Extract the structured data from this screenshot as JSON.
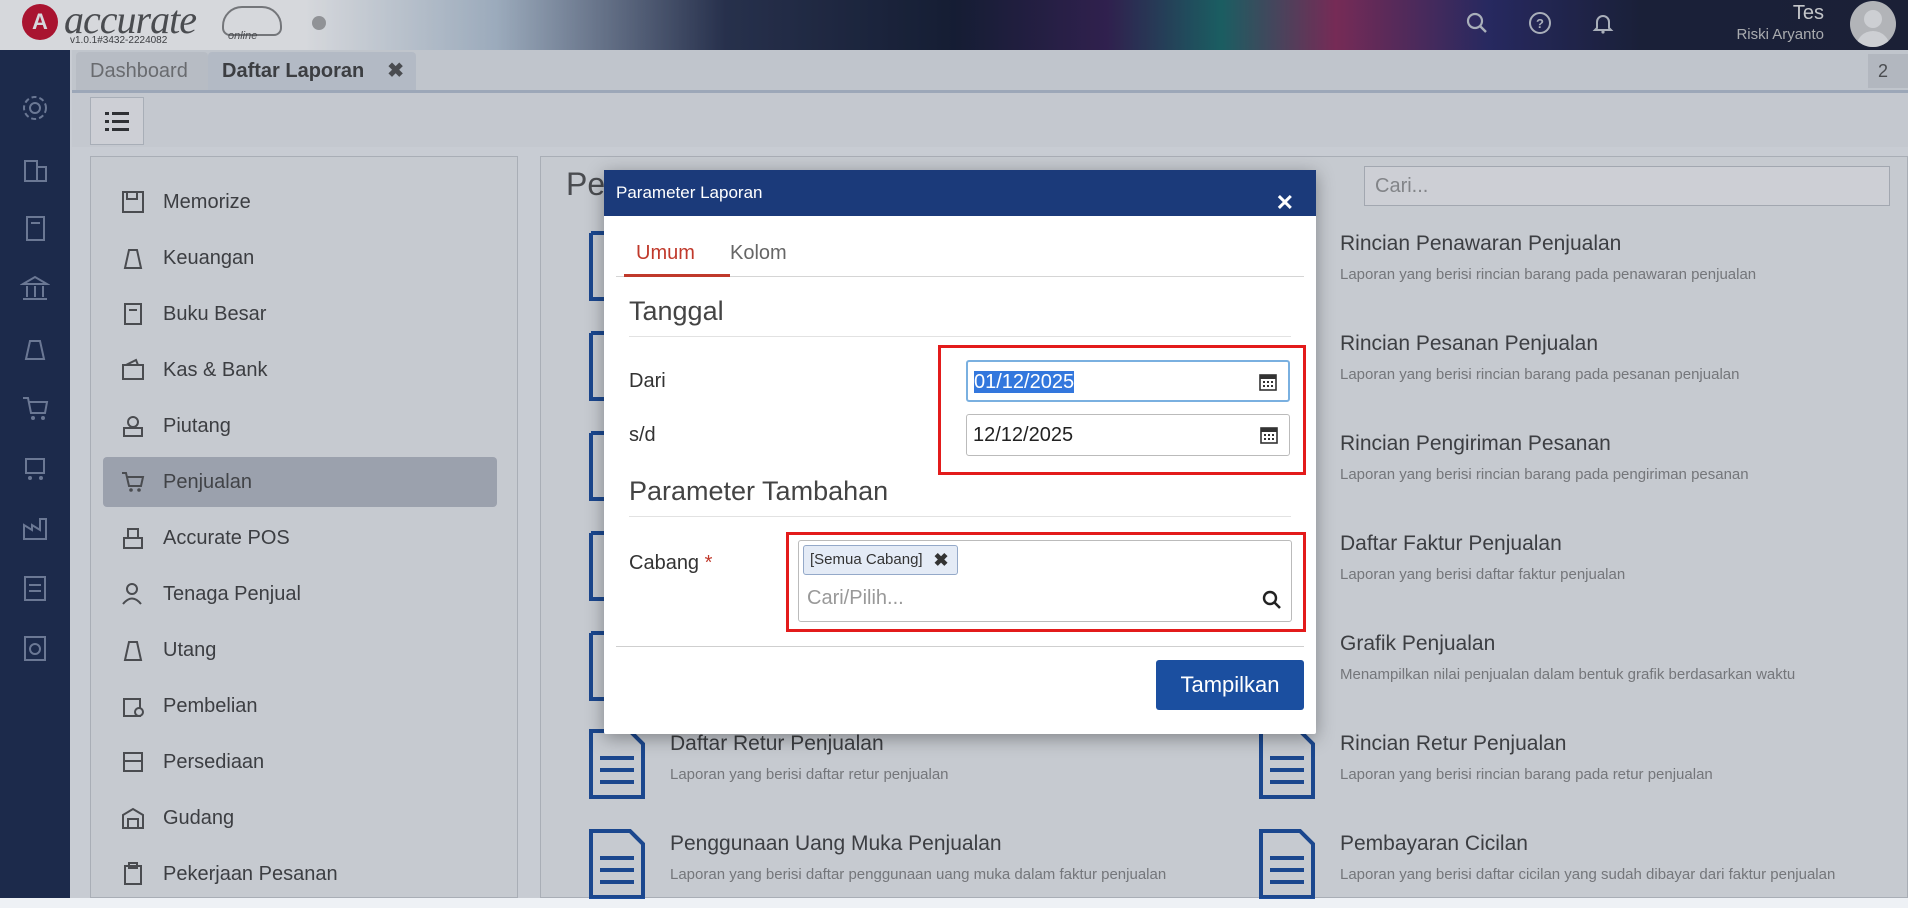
{
  "app": {
    "logo_text": "accurate",
    "logo_sub": "online",
    "version": "v1.0.1#3432-2224082",
    "user_name": "Tes",
    "user_sub": "Riski Aryanto"
  },
  "tabs": {
    "dashboard": "Dashboard",
    "active": "Daftar Laporan",
    "count": "2"
  },
  "sidebar": {
    "items": [
      {
        "label": "Memorize",
        "icon": "save-icon"
      },
      {
        "label": "Keuangan",
        "icon": "money-bag-icon"
      },
      {
        "label": "Buku Besar",
        "icon": "ledger-icon"
      },
      {
        "label": "Kas & Bank",
        "icon": "wallet-icon"
      },
      {
        "label": "Piutang",
        "icon": "receivable-icon"
      },
      {
        "label": "Penjualan",
        "icon": "cart-icon"
      },
      {
        "label": "Accurate POS",
        "icon": "pos-icon"
      },
      {
        "label": "Tenaga Penjual",
        "icon": "salesperson-icon"
      },
      {
        "label": "Utang",
        "icon": "debt-icon"
      },
      {
        "label": "Pembelian",
        "icon": "purchase-icon"
      },
      {
        "label": "Persediaan",
        "icon": "inventory-icon"
      },
      {
        "label": "Gudang",
        "icon": "warehouse-icon"
      },
      {
        "label": "Pekerjaan Pesanan",
        "icon": "job-order-icon"
      }
    ]
  },
  "main": {
    "title": "Pe",
    "search_placeholder": "Cari...",
    "reports_left": [
      {
        "title": "Daftar Retur Penjualan",
        "desc": "Laporan yang berisi daftar retur penjualan"
      },
      {
        "title": "Penggunaan Uang Muka Penjualan",
        "desc": "Laporan yang berisi daftar penggunaan uang muka dalam faktur penjualan"
      }
    ],
    "reports_right": [
      {
        "title": "Rincian Penawaran Penjualan",
        "desc": "Laporan yang berisi rincian barang pada penawaran penjualan"
      },
      {
        "title": "Rincian Pesanan Penjualan",
        "desc": "Laporan yang berisi rincian barang pada pesanan penjualan"
      },
      {
        "title": "Rincian Pengiriman Pesanan",
        "desc": "Laporan yang berisi rincian barang pada pengiriman pesanan"
      },
      {
        "title": "Daftar Faktur Penjualan",
        "desc": "Laporan yang berisi daftar faktur penjualan"
      },
      {
        "title": "Grafik Penjualan",
        "desc": "Menampilkan nilai penjualan dalam bentuk grafik berdasarkan waktu"
      },
      {
        "title": "Rincian Retur Penjualan",
        "desc": "Laporan yang berisi rincian barang pada retur penjualan"
      },
      {
        "title": "Pembayaran Cicilan",
        "desc": "Laporan yang berisi daftar cicilan yang sudah dibayar dari faktur penjualan"
      }
    ]
  },
  "modal": {
    "title": "Parameter Laporan",
    "close": "✕",
    "tab_umum": "Umum",
    "tab_kolom": "Kolom",
    "section_tanggal": "Tanggal",
    "label_dari": "Dari",
    "value_dari": "01/12/2025",
    "label_sd": "s/d",
    "value_sd": "12/12/2025",
    "section_tambahan": "Parameter Tambahan",
    "label_cabang": "Cabang",
    "required_mark": "*",
    "chip_cabang": "[Semua Cabang]",
    "chip_remove": "✖",
    "cabang_placeholder": "Cari/Pilih...",
    "button_show": "Tampilkan"
  },
  "colors": {
    "accent_red": "#c0392b",
    "modal_header": "#1b3a7a",
    "button_blue": "#1b4fa0",
    "highlight_box": "#e31b1b"
  }
}
